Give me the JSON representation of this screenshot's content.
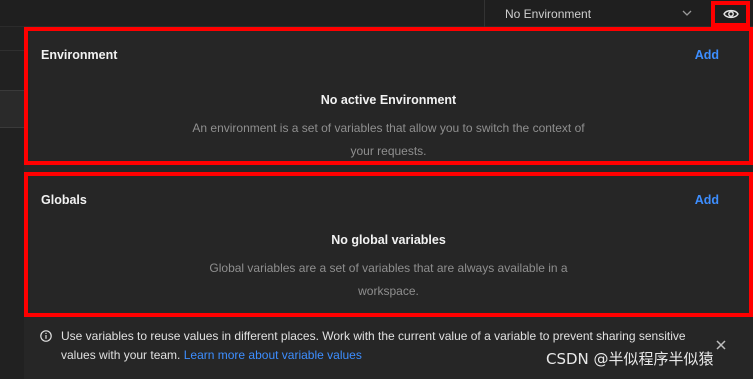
{
  "toolbar": {
    "environment_selector": "No Environment",
    "eye_icon": "eye-icon",
    "chevron_icon": "chevron-down-icon"
  },
  "environment": {
    "title": "Environment",
    "add_label": "Add",
    "empty_title": "No active Environment",
    "empty_desc": "An environment is a set of variables that allow you to switch the context of your requests."
  },
  "globals": {
    "title": "Globals",
    "add_label": "Add",
    "empty_title": "No global variables",
    "empty_desc": "Global variables are a set of variables that are always available in a workspace."
  },
  "info": {
    "icon": "info-icon",
    "message": "Use variables to reuse values in different places. Work with the current value of a variable to prevent sharing sensitive values with your team.",
    "link": "Learn more about variable values",
    "close_icon": "close-icon"
  },
  "watermark": "CSDN @半似程序半似猿",
  "colors": {
    "background": "#1f1f1f",
    "panel": "#262626",
    "accent": "#3d8eff",
    "highlight_border": "#ff0000"
  }
}
